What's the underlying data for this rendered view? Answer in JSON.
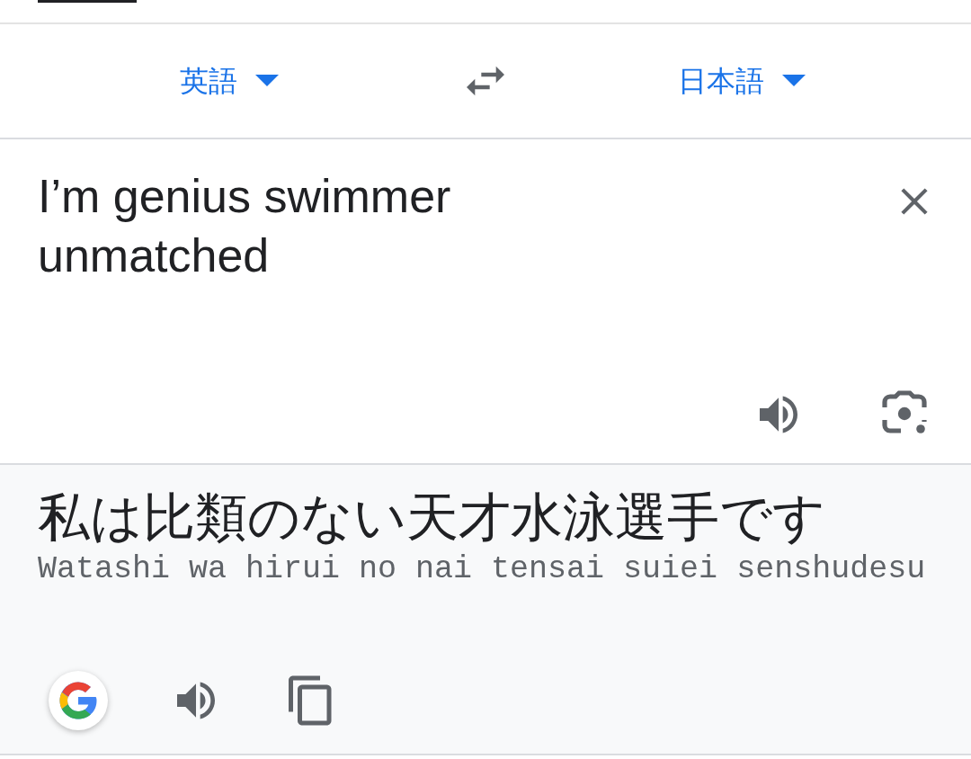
{
  "language_bar": {
    "source_language": "英語",
    "target_language": "日本語"
  },
  "input": {
    "text": "I’m genius swimmer unmatched"
  },
  "output": {
    "translation": "私は比類のない天才水泳選手です",
    "romanization": "Watashi wa hirui no nai tensai suiei senshudesu"
  }
}
